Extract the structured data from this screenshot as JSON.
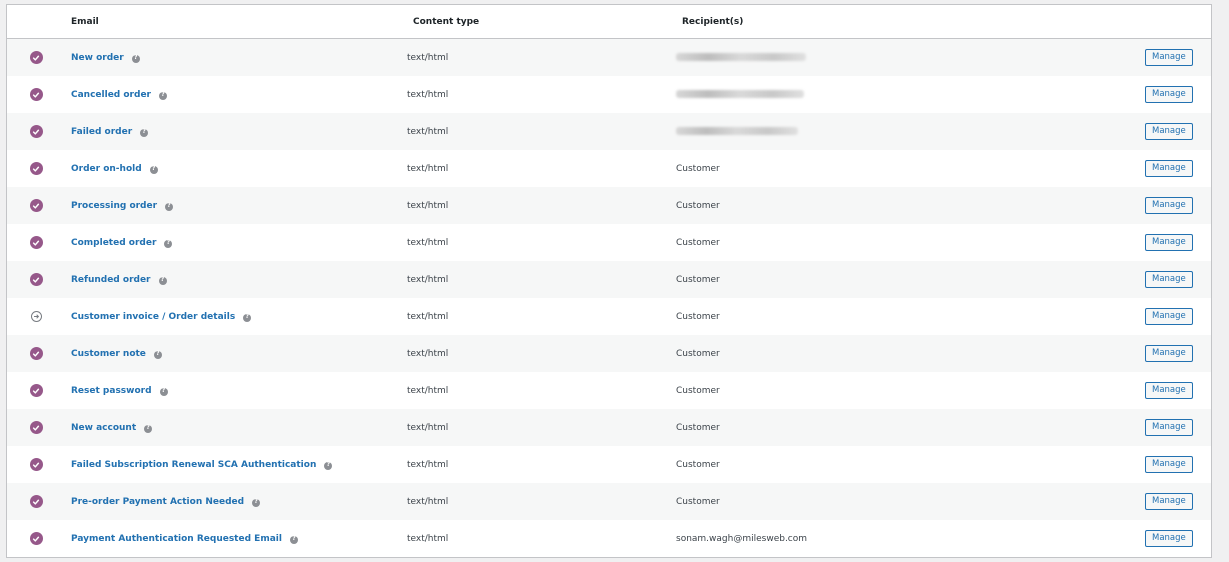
{
  "header": {
    "email": "Email",
    "content_type": "Content type",
    "recipients": "Recipient(s)"
  },
  "colors": {
    "enabled": "#96588a",
    "link": "#2271b1"
  },
  "rows": [
    {
      "name": "New order",
      "type": "text/html",
      "recipient": "",
      "recipient_redacted": true,
      "status": "enabled",
      "action": "Manage"
    },
    {
      "name": "Cancelled order",
      "type": "text/html",
      "recipient": "",
      "recipient_redacted": true,
      "status": "enabled",
      "action": "Manage"
    },
    {
      "name": "Failed order",
      "type": "text/html",
      "recipient": "",
      "recipient_redacted": true,
      "status": "enabled",
      "action": "Manage"
    },
    {
      "name": "Order on-hold",
      "type": "text/html",
      "recipient": "Customer",
      "status": "enabled",
      "action": "Manage"
    },
    {
      "name": "Processing order",
      "type": "text/html",
      "recipient": "Customer",
      "status": "enabled",
      "action": "Manage"
    },
    {
      "name": "Completed order",
      "type": "text/html",
      "recipient": "Customer",
      "status": "enabled",
      "action": "Manage"
    },
    {
      "name": "Refunded order",
      "type": "text/html",
      "recipient": "Customer",
      "status": "enabled",
      "action": "Manage"
    },
    {
      "name": "Customer invoice / Order details",
      "type": "text/html",
      "recipient": "Customer",
      "status": "manual",
      "action": "Manage"
    },
    {
      "name": "Customer note",
      "type": "text/html",
      "recipient": "Customer",
      "status": "enabled",
      "action": "Manage"
    },
    {
      "name": "Reset password",
      "type": "text/html",
      "recipient": "Customer",
      "status": "enabled",
      "action": "Manage"
    },
    {
      "name": "New account",
      "type": "text/html",
      "recipient": "Customer",
      "status": "enabled",
      "action": "Manage"
    },
    {
      "name": "Failed Subscription Renewal SCA Authentication",
      "type": "text/html",
      "recipient": "Customer",
      "status": "enabled",
      "action": "Manage"
    },
    {
      "name": "Pre-order Payment Action Needed",
      "type": "text/html",
      "recipient": "Customer",
      "status": "enabled",
      "action": "Manage"
    },
    {
      "name": "Payment Authentication Requested Email",
      "type": "text/html",
      "recipient": "sonam.wagh@milesweb.com",
      "status": "enabled",
      "action": "Manage"
    }
  ]
}
